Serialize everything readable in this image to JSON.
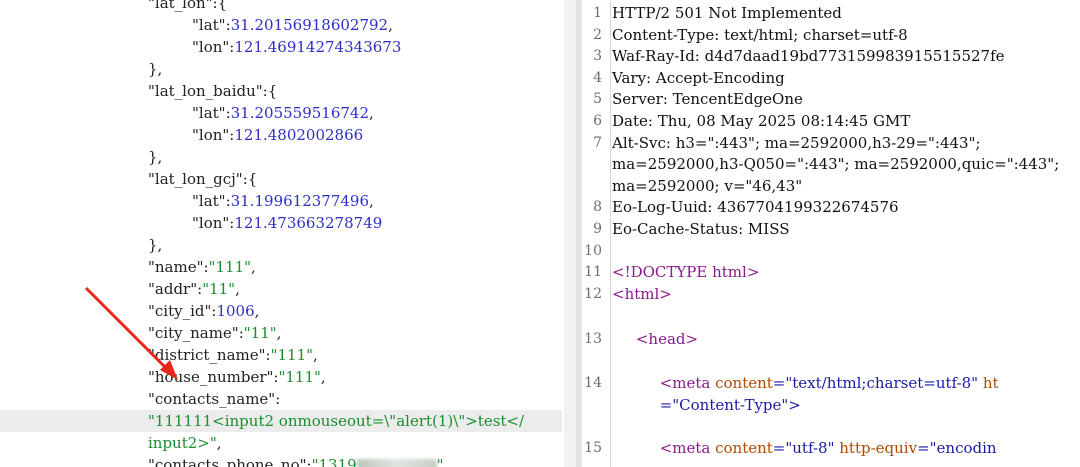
{
  "left": {
    "lines": [
      {
        "i": "",
        "t": "\"lat_lon\":{",
        "cut": true
      },
      {
        "i": "    ",
        "k": "\"lat\"",
        "v": "31.20156918602792",
        "vt": "num",
        "e": ","
      },
      {
        "i": "    ",
        "k": "\"lon\"",
        "v": "121.46914274343673",
        "vt": "num",
        "e": ""
      },
      {
        "i": "",
        "p": "},"
      },
      {
        "i": "",
        "k": "\"lat_lon_baidu\"",
        "p2": ":{"
      },
      {
        "i": "    ",
        "k": "\"lat\"",
        "v": "31.205559516742",
        "vt": "num",
        "e": ","
      },
      {
        "i": "    ",
        "k": "\"lon\"",
        "v": "121.4802002866",
        "vt": "num",
        "e": ""
      },
      {
        "i": "",
        "p": "},"
      },
      {
        "i": "",
        "k": "\"lat_lon_gcj\"",
        "p2": ":{"
      },
      {
        "i": "    ",
        "k": "\"lat\"",
        "v": "31.199612377496",
        "vt": "num",
        "e": ","
      },
      {
        "i": "    ",
        "k": "\"lon\"",
        "v": "121.473663278749",
        "vt": "num",
        "e": ""
      },
      {
        "i": "",
        "p": "},"
      },
      {
        "i": "",
        "k": "\"name\"",
        "v": "\"111\"",
        "vt": "str",
        "e": ","
      },
      {
        "i": "",
        "k": "\"addr\"",
        "v": "\"11\"",
        "vt": "str",
        "e": ","
      },
      {
        "i": "",
        "k": "\"city_id\"",
        "v": "1006",
        "vt": "num",
        "e": ","
      },
      {
        "i": "",
        "k": "\"city_name\"",
        "v": "\"11\"",
        "vt": "str",
        "e": ","
      },
      {
        "i": "",
        "k": "\"district_name\"",
        "v": "\"111\"",
        "vt": "str",
        "e": ","
      },
      {
        "i": "",
        "k": "\"house_number\"",
        "v": "\"111\"",
        "vt": "str",
        "e": ","
      },
      {
        "i": "",
        "k": "\"contacts_name\"",
        "p2": ":"
      },
      {
        "i": "",
        "v": "\"111111<input2 onmouseout=\\\"alert(1)\\\">test</",
        "vt": "str",
        "hl": true
      },
      {
        "i": "",
        "v": "input2>\"",
        "vt": "str",
        "e": ","
      },
      {
        "i": "",
        "k": "\"contacts_phone_no\"",
        "v": "\"1319",
        "vt": "str",
        "blur": true,
        "e2": "\","
      }
    ]
  },
  "right": {
    "lines": [
      {
        "n": "1",
        "t": "HTTP/2 501 Not Implemented"
      },
      {
        "n": "2",
        "t": "Content-Type: text/html; charset=utf-8"
      },
      {
        "n": "3",
        "t": "Waf-Ray-Id: d4d7daad19bd773159983915515527fe"
      },
      {
        "n": "4",
        "t": "Vary: Accept-Encoding"
      },
      {
        "n": "5",
        "t": "Server: TencentEdgeOne"
      },
      {
        "n": "6",
        "t": "Date: Thu, 08 May 2025 08:14:45 GMT"
      },
      {
        "n": "7",
        "t": "Alt-Svc: h3=\":443\"; ma=2592000,h3-29=\":443\";"
      },
      {
        "n": "",
        "t": "ma=2592000,h3-Q050=\":443\"; ma=2592000,quic=\":443\";"
      },
      {
        "n": "",
        "t": "ma=2592000; v=\"46,43\""
      },
      {
        "n": "8",
        "t": "Eo-Log-Uuid: 4367704199322674576"
      },
      {
        "n": "9",
        "t": "Eo-Cache-Status: MISS"
      },
      {
        "n": "10",
        "t": ""
      },
      {
        "n": "11",
        "t": "<!DOCTYPE html>",
        "tag": true
      },
      {
        "n": "12",
        "t": "<html>",
        "tag": true
      }
    ],
    "html_lines": [
      {
        "n": "13",
        "indent": "     ",
        "t": "<head>"
      },
      {
        "n": "14",
        "indent": "          ",
        "tag": "<meta ",
        "a1": "content",
        "v1": "=\"text/html;charset=utf-8\"",
        "a2": " ht",
        "cont": "=\"Content-Type\">"
      },
      {
        "n": "15",
        "indent": "          ",
        "tag": "<meta ",
        "a1": "content",
        "v1": "=\"utf-8\"",
        "a2": " http-equiv",
        "v2": "=\"encodin"
      }
    ]
  }
}
